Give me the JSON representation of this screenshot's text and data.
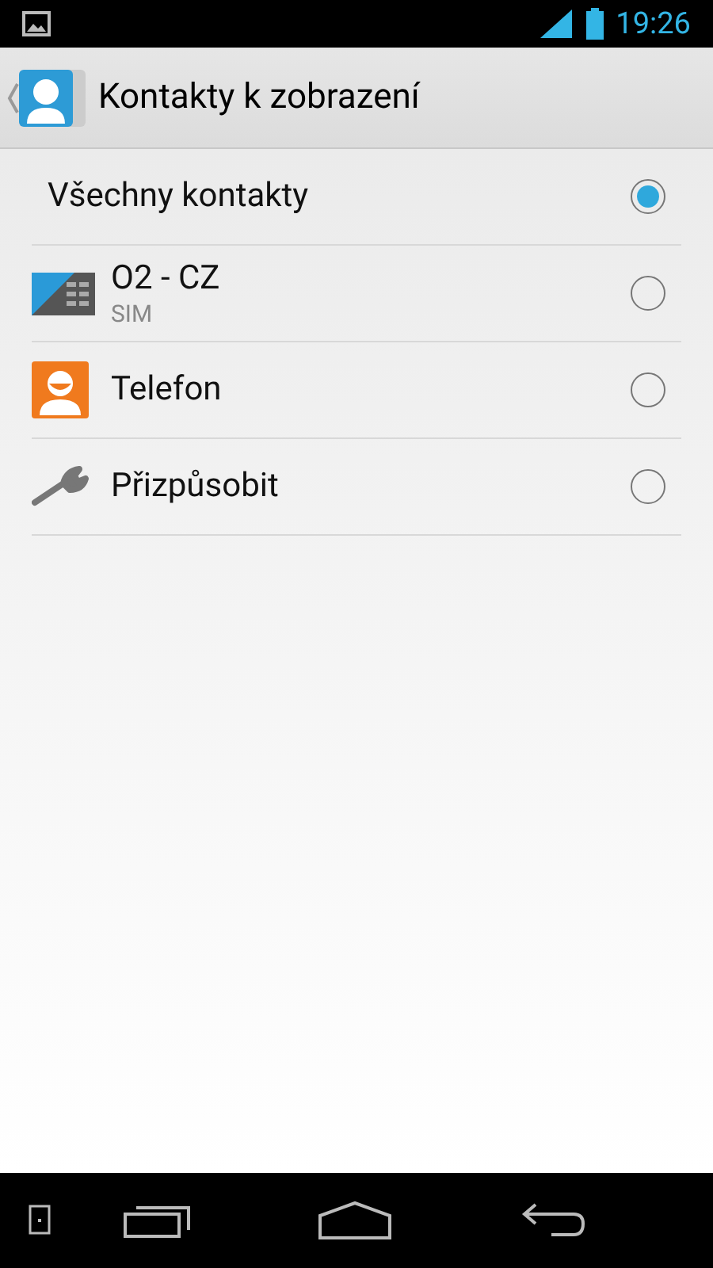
{
  "status_bar": {
    "time": "19:26"
  },
  "action_bar": {
    "title": "Kontakty k zobrazení"
  },
  "items": [
    {
      "kind": "plain",
      "label": "Všechny kontakty",
      "selected": true
    },
    {
      "kind": "sim",
      "label": "O2 - CZ",
      "sublabel": "SIM",
      "selected": false
    },
    {
      "kind": "phone",
      "label": "Telefon",
      "selected": false
    },
    {
      "kind": "wrench",
      "label": "Přizpůsobit",
      "selected": false
    }
  ]
}
